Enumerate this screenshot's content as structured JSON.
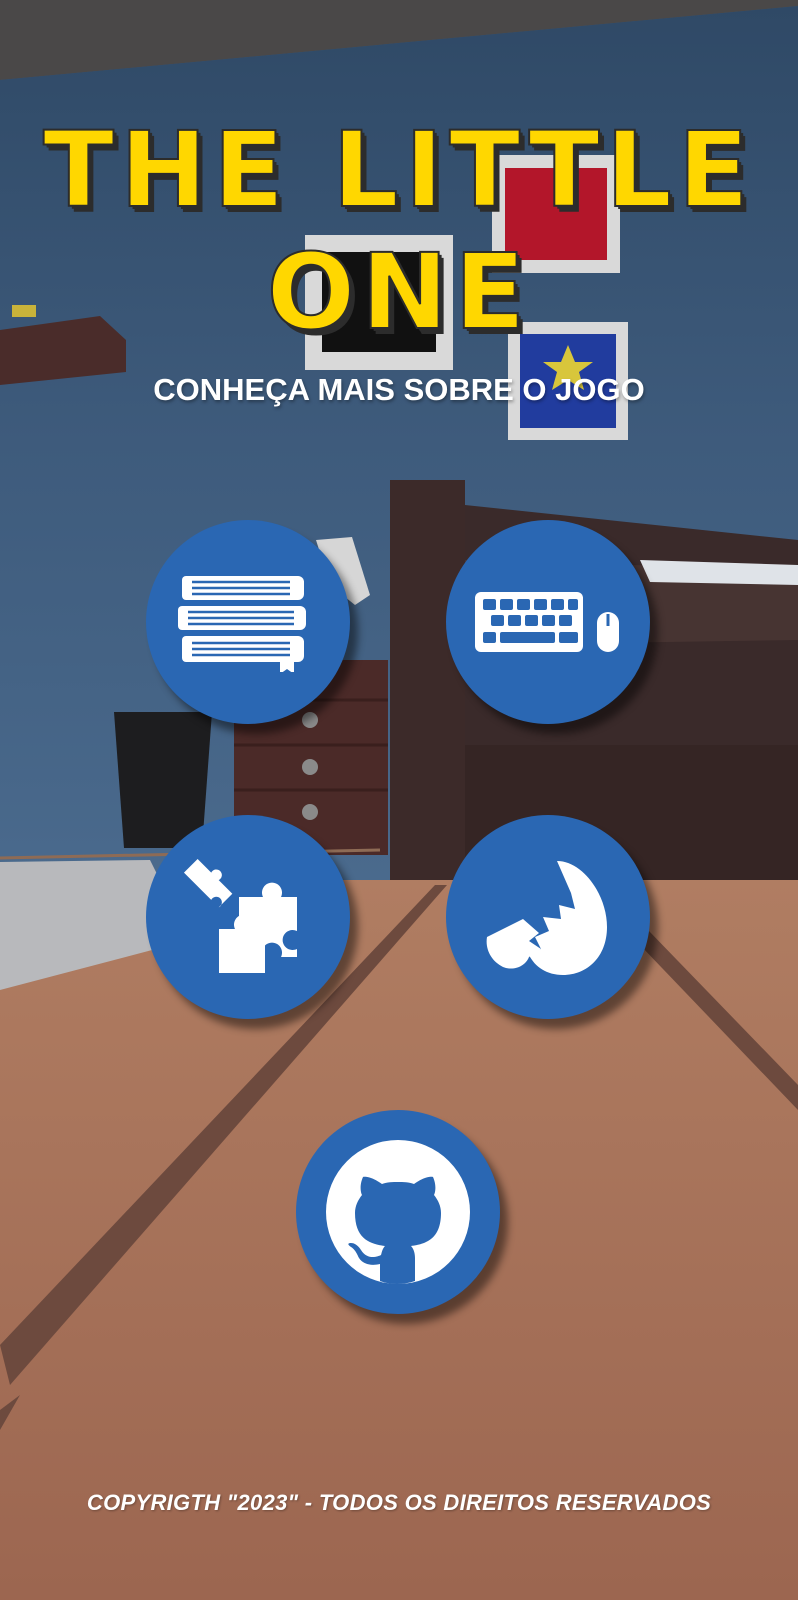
{
  "title": {
    "line1": "THE LITTLE",
    "line2": "ONE"
  },
  "subtitle": "CONHEÇA MAIS SOBRE O JOGO",
  "menu": [
    {
      "icon": "books-icon"
    },
    {
      "icon": "keyboard-mouse-icon"
    },
    {
      "icon": "puzzle-icon"
    },
    {
      "icon": "cracked-egg-icon"
    },
    {
      "icon": "github-icon"
    }
  ],
  "footer": {
    "copyright": "COPYRIGTH \"2023\" - TODOS OS DIREITOS RESERVADOS"
  },
  "colors": {
    "title": "#ffd700",
    "button": "#2a67b3",
    "wall": "#3a5573",
    "floor": "#a86e55"
  }
}
